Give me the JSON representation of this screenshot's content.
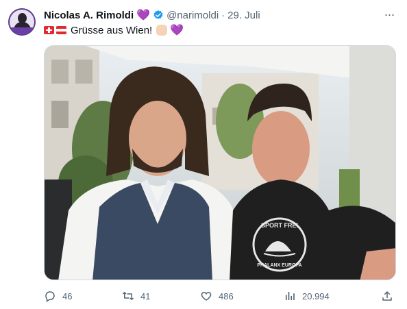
{
  "tweet": {
    "author_name": "Nicolas A. Rimoldi",
    "name_emoji": "💜",
    "handle": "@narimoldi",
    "separator": "·",
    "date": "29. Juli",
    "more_label": "···",
    "text": "Grüsse aus Wien!",
    "text_emoji_heart": "💜"
  },
  "actions": {
    "replies": "46",
    "retweets": "41",
    "likes": "486",
    "views": "20.994"
  },
  "photo": {
    "shirt_text_top": "SPORT FREI",
    "shirt_text_bottom": "PHALANX EUROPA"
  },
  "colors": {
    "verified_blue": "#1d9bf0",
    "muted_text": "#536471",
    "purple_heart": "#9b6fd6"
  },
  "icons": [
    "avatar",
    "verified-badge-icon",
    "more-icon",
    "swiss-flag-icon",
    "austrian-flag-icon",
    "raised-fist-icon",
    "purple-heart-icon",
    "reply-icon",
    "retweet-icon",
    "like-icon",
    "views-icon",
    "share-icon"
  ]
}
